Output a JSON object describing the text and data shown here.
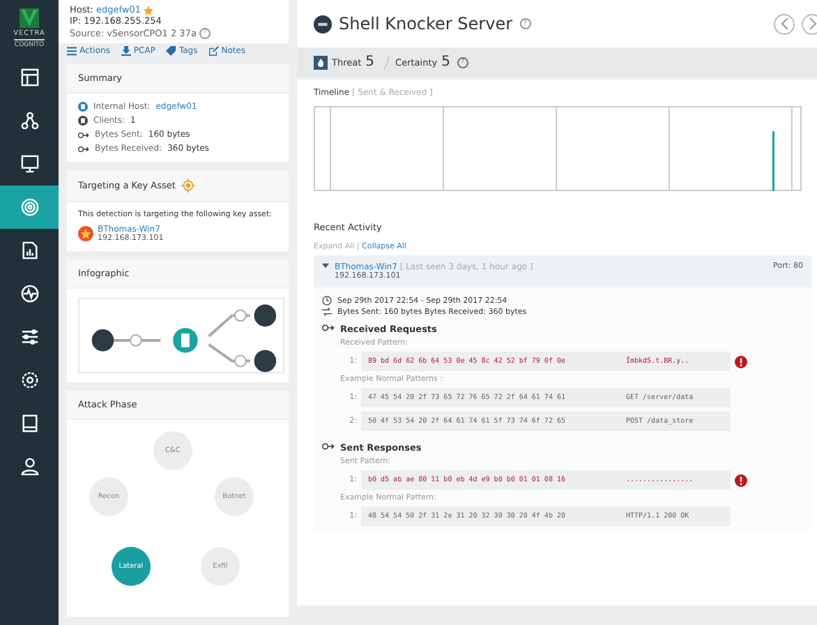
{
  "logo": {
    "name": "VECTRA",
    "sub": "COGNITO"
  },
  "nav": [
    {
      "selected": false
    },
    {
      "selected": false
    },
    {
      "selected": false
    },
    {
      "selected": true
    },
    {
      "selected": false
    },
    {
      "selected": false
    },
    {
      "selected": false
    },
    {
      "selected": false
    },
    {
      "selected": false
    },
    {
      "selected": false
    }
  ],
  "host": {
    "label": "Host:",
    "name": "edgefw01",
    "starred": true,
    "ip": "IP: 192.168.255.254",
    "source": "Source: vSensorCPO1 2 37a",
    "help": "?"
  },
  "toolbar": [
    {
      "label": "Actions"
    },
    {
      "label": "PCAP"
    },
    {
      "label": "Tags"
    },
    {
      "label": "Notes"
    }
  ],
  "summary": {
    "title": "Summary",
    "rows": [
      {
        "kind": "host",
        "label": "Internal Host:",
        "value": "edgefw01",
        "link": true
      },
      {
        "kind": "host",
        "label": "Clients:",
        "value": "1",
        "link": false
      },
      {
        "kind": "traffic",
        "label": "Bytes Sent:",
        "value": "160 bytes",
        "link": false
      },
      {
        "kind": "traffic",
        "label": "Bytes Received:",
        "value": "360 bytes",
        "link": false
      }
    ]
  },
  "key_asset": {
    "title": "Targeting a Key Asset",
    "text": "This detection is targeting the following key asset:",
    "host": "BThomas-Win7",
    "ip": "192.168.173.101"
  },
  "infographic": {
    "title": "Infographic"
  },
  "attack_phase": {
    "title": "Attack Phase",
    "phases": [
      {
        "label": "C&C",
        "selected": false
      },
      {
        "label": "Botnet",
        "selected": false
      },
      {
        "label": "Exfil",
        "selected": false
      },
      {
        "label": "Lateral",
        "selected": true
      },
      {
        "label": "Recon",
        "selected": false
      }
    ]
  },
  "detection": {
    "title": "Shell Knocker Server",
    "help": "?",
    "threat_label": "Threat",
    "threat": "5",
    "certainty_label": "Certainty",
    "certainty": "5",
    "score_help": "?"
  },
  "timeline": {
    "title": "Timeline",
    "subtitle": "[ Sent & Received ]"
  },
  "recent": {
    "title": "Recent Activity",
    "expand": "Expand All",
    "separator": "|",
    "collapse": "Collapse All"
  },
  "activity": {
    "expanded": true,
    "host": "BThomas-Win7",
    "seen": "[ Last seen 3 days, 1 hour ago ]",
    "ip": "192.168.173.101",
    "port": "Port: 80",
    "time": "Sep 29th 2017 22:54 - Sep 29th 2017 22:54",
    "bytes": "Bytes Sent: 160 bytes   Bytes Received: 360 bytes",
    "sections": [
      {
        "title": "Received Requests",
        "groups": [
          {
            "label": "Received Pattern:",
            "rows": [
              {
                "num": "1:",
                "hex": "89 bd 6d 62 6b 64 53 0e 45 8c 42 52 bf 79 0f 0e",
                "ascii": "ÎmbkdS.t.BR.y..",
                "alert": true
              }
            ]
          },
          {
            "label": "Example Normal Patterns :",
            "rows": [
              {
                "num": "1:",
                "hex": "47 45 54 20 2f 73 65 72 76 65 72 2f 64 61 74 61",
                "ascii": "GET /server/data",
                "alert": false
              },
              {
                "num": "2:",
                "hex": "50 4f 53 54 20 2f 64 61 74 61 5f 73 74 6f 72 65",
                "ascii": "POST /data_store",
                "alert": false
              }
            ]
          }
        ]
      },
      {
        "title": "Sent Responses",
        "groups": [
          {
            "label": "Sent Pattern:",
            "rows": [
              {
                "num": "1:",
                "hex": "b0 d5 ab ae 80 11 b0 eb 4d e9 b0 b0 01 01 08 16",
                "ascii": "................",
                "alert": true
              }
            ]
          },
          {
            "label": "Example Normal Pattern:",
            "rows": [
              {
                "num": "1:",
                "hex": "48 54 54 50 2f 31 2e 31 20 32 30 30 20 4f 4b 20",
                "ascii": "HTTP/1.1 200 OK",
                "alert": false
              }
            ]
          }
        ]
      }
    ]
  }
}
